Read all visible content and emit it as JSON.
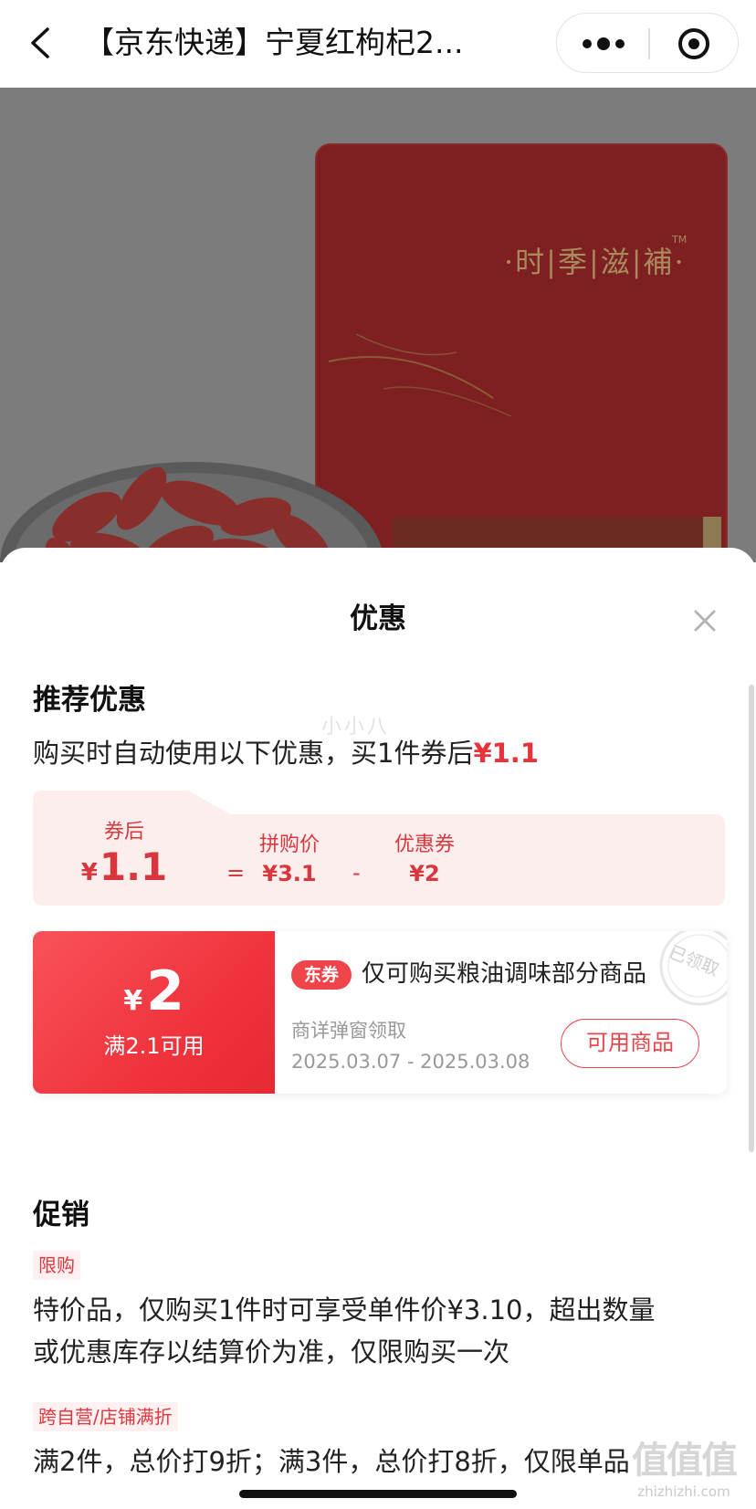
{
  "navbar": {
    "title": "【京东快递】宁夏红枸杞2...",
    "back_icon": "chevron-left-icon",
    "more_icon": "more-dots-icon",
    "close_icon": "target-circle-icon"
  },
  "product_image": {
    "package_text": "·时|季|滋|補·",
    "trademark": "TM"
  },
  "sheet": {
    "title": "优惠",
    "close_icon": "close-icon"
  },
  "recommended": {
    "heading": "推荐优惠",
    "desc_prefix": "购买时自动使用以下优惠，买1件券后",
    "desc_price": "¥1.1",
    "watermark": "小小八",
    "calc": {
      "after_label": "券后",
      "after_yen": "¥",
      "after_value": "1.1",
      "eq": "=",
      "group_label": "拼购价",
      "group_value": "¥3.1",
      "minus": "-",
      "coupon_label": "优惠券",
      "coupon_value": "¥2"
    }
  },
  "coupon": {
    "yen": "¥",
    "amount": "2",
    "condition": "满2.1可用",
    "tag": "东券",
    "description": "仅可购买粮油调味部分商品",
    "source": "商详弹窗领取",
    "date_range": "2025.03.07 - 2025.03.08",
    "button_label": "可用商品",
    "stamp_text": "已领取"
  },
  "promotion": {
    "heading": "促销",
    "items": [
      {
        "tag": "限购",
        "line1": "特价品，仅购买1件时可享受单件价¥3.10，超出数量",
        "line2": "或优惠库存以结算价为准，仅限购买一次"
      },
      {
        "tag": "跨自营/店铺满折",
        "line1": "满2件，总价打9折；满3件，总价打8折，仅限单品"
      }
    ]
  },
  "site_logo": {
    "brand": "值值值",
    "url": "zhizhizhi.com"
  },
  "colors": {
    "accent_red": "#e8333a",
    "overlay_gray": "#7c7c7c",
    "calc_bg": "#fdeeee"
  }
}
